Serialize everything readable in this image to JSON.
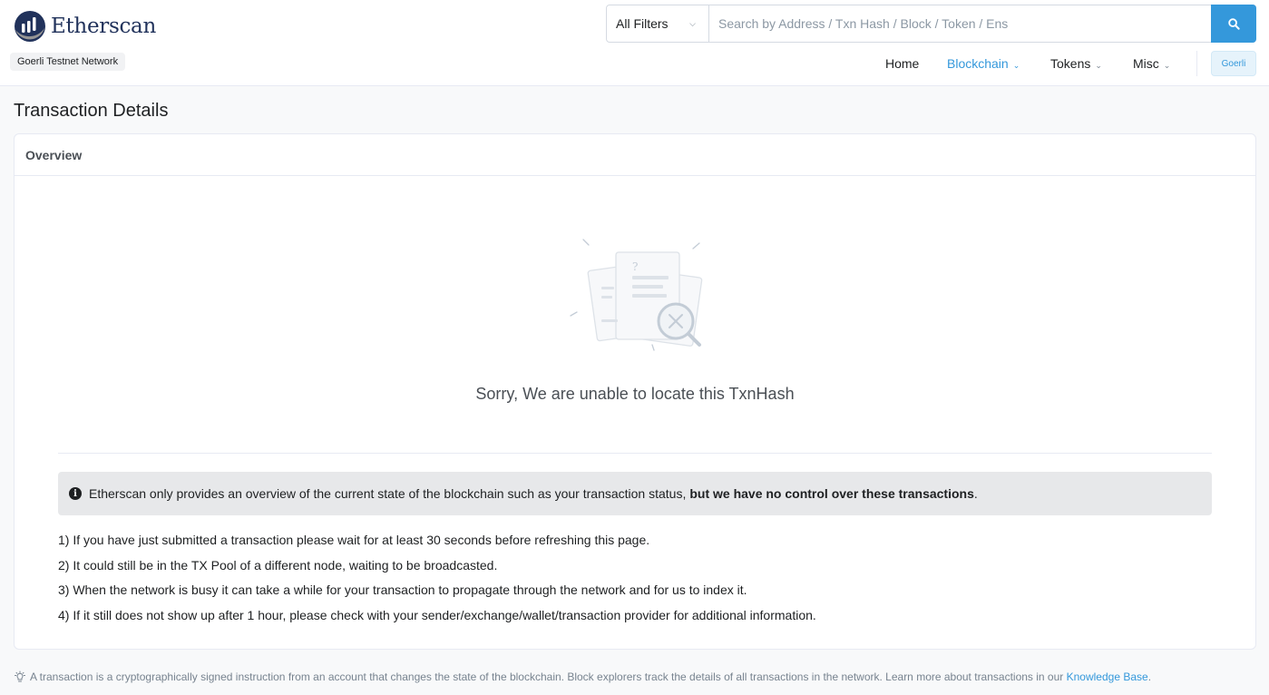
{
  "brand": {
    "name": "Etherscan",
    "network": "Goerli Testnet Network"
  },
  "search": {
    "filter_label": "All Filters",
    "placeholder": "Search by Address / Txn Hash / Block / Token / Ens",
    "value": ""
  },
  "nav": {
    "items": [
      {
        "label": "Home"
      },
      {
        "label": "Blockchain"
      },
      {
        "label": "Tokens"
      },
      {
        "label": "Misc"
      }
    ],
    "network_button": "Goerli"
  },
  "page": {
    "title": "Transaction Details",
    "tab": "Overview",
    "error_message": "Sorry, We are unable to locate this TxnHash",
    "alert_text": "Etherscan only provides an overview of the current state of the blockchain such as your transaction status,",
    "alert_bold": "but we have no control over these transactions",
    "alert_end": ".",
    "tips": [
      "1) If you have just submitted a transaction please wait for at least 30 seconds before refreshing this page.",
      "2) It could still be in the TX Pool of a different node, waiting to be broadcasted.",
      "3) When the network is busy it can take a while for your transaction to propagate through the network and for us to index it.",
      "4) If it still does not show up after 1 hour, please check with your sender/exchange/wallet/transaction provider for additional information."
    ]
  },
  "footer": {
    "note": "A transaction is a cryptographically signed instruction from an account that changes the state of the blockchain. Block explorers track the details of all transactions in the network. Learn more about transactions in our ",
    "link": "Knowledge Base",
    "end": "."
  },
  "icons": {
    "logo": "etherscan-logo-icon",
    "search": "search-icon",
    "info": "info-icon",
    "bulb": "lightbulb-icon",
    "not_found": "document-search-illustration"
  },
  "colors": {
    "accent": "#3498db",
    "brand_navy": "#21325b"
  }
}
